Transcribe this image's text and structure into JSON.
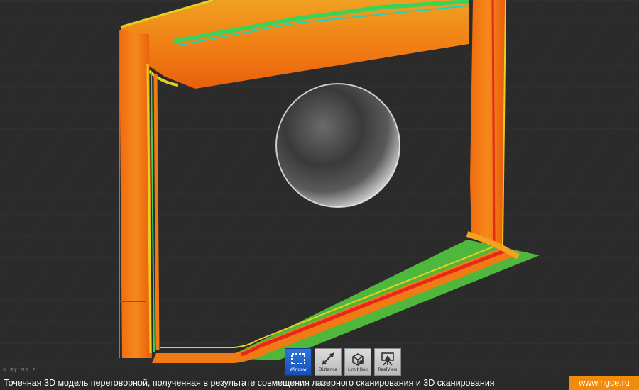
{
  "viewer": {
    "axis_indicator": "x·my·mz·m",
    "background": "#2b2b2b",
    "scan_palette": {
      "orange": "#f07a14",
      "red": "#e8281c",
      "yellow": "#e6d21e",
      "green": "#3cd25a",
      "cyan": "#22d2b8"
    },
    "sphere_target": "gray-scan-sphere"
  },
  "toolbar": {
    "tools": [
      {
        "label": "Window",
        "icon": "window-select-icon",
        "active": true
      },
      {
        "label": "Distance",
        "icon": "distance-measure-icon",
        "active": false
      },
      {
        "label": "Limit Box",
        "icon": "limit-box-icon",
        "active": false
      },
      {
        "label": "RealView",
        "icon": "realview-icon",
        "active": false
      }
    ]
  },
  "caption": {
    "text": "Точечная 3D модель переговорной, полученная в результате совмещения лазерного сканирования и 3D сканирования",
    "link": "www.ngce.ru",
    "link_bg": "#f28a0c"
  }
}
